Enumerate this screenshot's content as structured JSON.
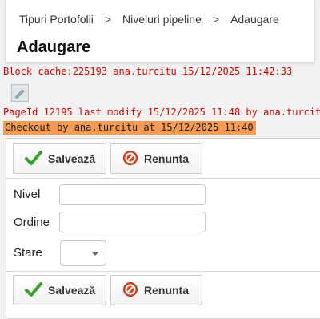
{
  "breadcrumb": {
    "items": [
      "Tipuri Portofolii",
      "Niveluri pipeline",
      "Adaugare"
    ],
    "separator": ">"
  },
  "page_title": "Adaugare",
  "debug": {
    "block_cache": "Block cache:225193 ana.turcitu 15/12/2025 11:42:33",
    "page_modify": "PageId 12195 last modify 15/12/2025 11:48 by ana.turcitu",
    "checkout": "Checkout by ana.turcitu at 15/12/2025 11:40"
  },
  "toolbar_top": {
    "save_label": "Salvează",
    "cancel_label": "Renunta"
  },
  "toolbar_bottom": {
    "save_label": "Salvează",
    "cancel_label": "Renunta"
  },
  "form": {
    "nivel": {
      "label": "Nivel",
      "value": "",
      "placeholder": ""
    },
    "ordine": {
      "label": "Ordine",
      "value": "",
      "placeholder": ""
    },
    "stare": {
      "label": "Stare",
      "selected": ""
    }
  },
  "icons": {
    "edit": "edit-pencil-icon",
    "save": "checkmark-icon",
    "cancel": "cancel-circle-icon",
    "select": "chevron-down-icon"
  },
  "colors": {
    "debug_text": "#d30000",
    "checkout_bg": "#f59c54",
    "save_check": "#3aa12f",
    "cancel_red": "#e2451f"
  }
}
